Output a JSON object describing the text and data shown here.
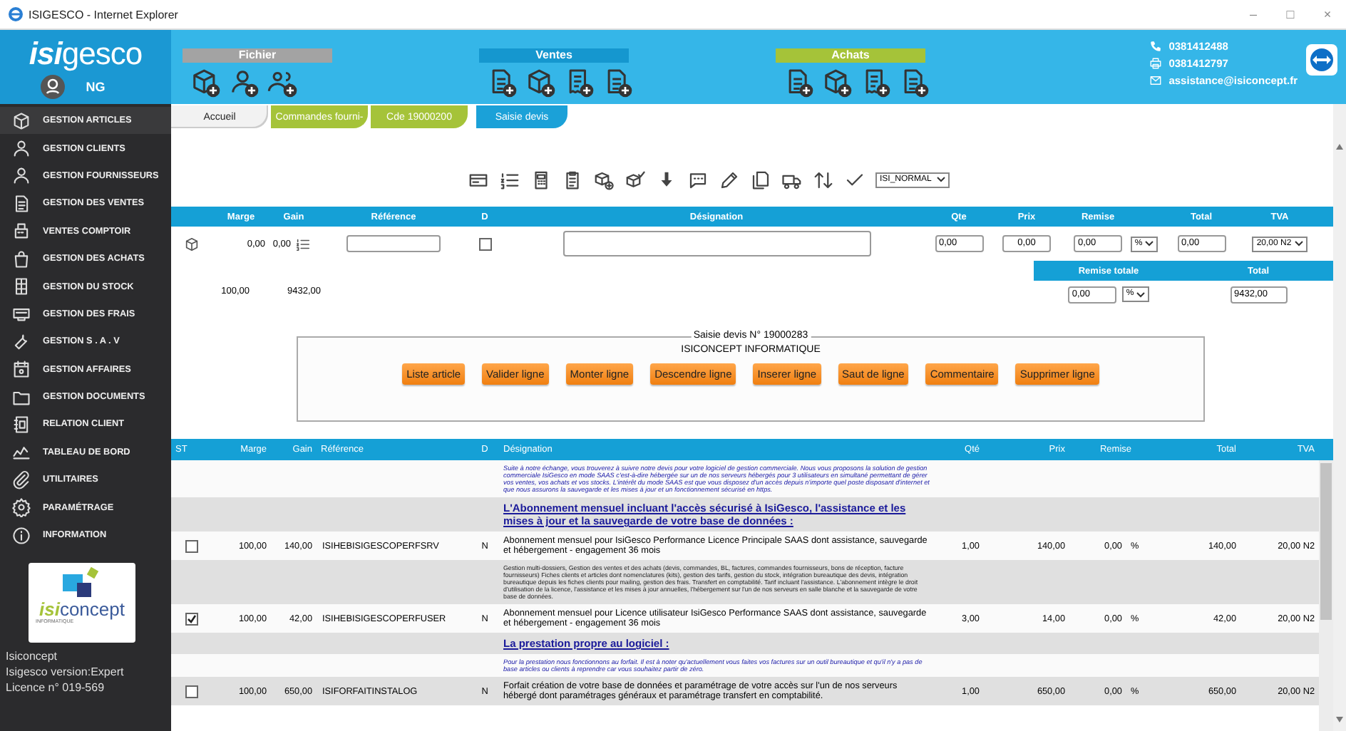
{
  "window": {
    "title": "ISIGESCO - Internet Explorer",
    "controls": [
      "–",
      "□",
      "×"
    ]
  },
  "header": {
    "logo": {
      "left": "isi",
      "right": "gesco"
    },
    "user": "NG",
    "groups": [
      {
        "label": "Fichier",
        "color": "#a3a3a3"
      },
      {
        "label": "Ventes",
        "color": "#1597cf"
      },
      {
        "label": "Achats",
        "color": "#a5c339"
      }
    ],
    "contacts": [
      {
        "kind": "phone",
        "text": "0381412488"
      },
      {
        "kind": "printer",
        "text": "0381412797"
      },
      {
        "kind": "mail",
        "text": "assistance@isiconcept.fr"
      }
    ]
  },
  "tabs": [
    {
      "label": "Accueil",
      "color": "#f2f2f2",
      "selected": false
    },
    {
      "label": "Commandes fourni-",
      "color": "#a5c339",
      "selected": false
    },
    {
      "label": "Cde 19000200",
      "color": "#a5c339",
      "selected": false
    },
    {
      "label": "Saisie devis",
      "color": "#1ba1d8",
      "selected": true
    }
  ],
  "sidebar": {
    "items": [
      {
        "label": "GESTION ARTICLES",
        "selected": true
      },
      {
        "label": "GESTION CLIENTS",
        "selected": false
      },
      {
        "label": "GESTION FOURNISSEURS",
        "selected": false
      },
      {
        "label": "GESTION DES VENTES",
        "selected": false
      },
      {
        "label": "VENTES COMPTOIR",
        "selected": false
      },
      {
        "label": "GESTION DES ACHATS",
        "selected": false
      },
      {
        "label": "GESTION DU STOCK",
        "selected": false
      },
      {
        "label": "GESTION DES FRAIS",
        "selected": false
      },
      {
        "label": "GESTION S . A . V",
        "selected": false
      },
      {
        "label": "GESTION AFFAIRES",
        "selected": false
      },
      {
        "label": "GESTION DOCUMENTS",
        "selected": false
      },
      {
        "label": "RELATION CLIENT",
        "selected": false
      },
      {
        "label": "TABLEAU DE BORD",
        "selected": false
      },
      {
        "label": "UTILITAIRES",
        "selected": false
      },
      {
        "label": "PARAMÉTRAGE",
        "selected": false
      },
      {
        "label": "INFORMATION",
        "selected": false
      }
    ],
    "brand": {
      "left": "isi",
      "right": "concept",
      "tagline": "INFORMATIQUE"
    },
    "footer": [
      "Isiconcept",
      "Isigesco version:Expert",
      "Licence n° 019-569"
    ]
  },
  "toolbar": {
    "select": "ISI_NORMAL"
  },
  "entry": {
    "columns": [
      "",
      "Marge",
      "Gain",
      "Référence",
      "D",
      "Désignation",
      "Qte",
      "Prix",
      "Remise",
      "",
      "Total",
      "TVA"
    ],
    "row": {
      "marge": "0,00",
      "gain": "0,00",
      "d_checked": false,
      "qte": "0,00",
      "prix": "0,00",
      "remise": "0,00",
      "remise_type": "%",
      "total": "0,00",
      "tva": "20,00 N2"
    },
    "totals": {
      "marge": "100,00",
      "gain": "9432,00",
      "remise_label": "Remise totale",
      "total_label": "Total",
      "remise": "0,00",
      "remise_type": "%",
      "total": "9432,00"
    }
  },
  "action_box": {
    "legend": "Saisie devis N° 19000283",
    "company": "ISICONCEPT INFORMATIQUE",
    "buttons": [
      "Liste article",
      "Valider ligne",
      "Monter ligne",
      "Descendre ligne",
      "Inserer ligne",
      "Saut de ligne",
      "Commentaire",
      "Supprimer ligne"
    ]
  },
  "lines": {
    "columns": [
      "ST",
      "Marge",
      "Gain",
      "Référence",
      "D",
      "Désignation",
      "Qté",
      "Prix",
      "Remise",
      "Total",
      "TVA"
    ],
    "rows": [
      {
        "kind": "comment",
        "text": "Suite à notre échange, vous trouverez à suivre notre devis pour votre logiciel de gestion commerciale. Nous vous proposons la solution de gestion commerciale IsiGesco en mode SAAS c'est-à-dire hébergée sur un de nos serveurs hébergés pour 3 utilisateurs en simultané permettant de gérer vos ventes, vos achats et vos stocks. L'intérêt du mode SAAS est que vous disposez d'un accès depuis n'importe quel poste disposant d'internet et que nous assurons la sauvegarde et les mises à jour et un fonctionnement sécurisé en https."
      },
      {
        "kind": "title",
        "text": "L'Abonnement mensuel incluant l'accès sécurisé à IsiGesco, l'assistance et les mises à jour et la sauvegarde de votre base de données :"
      },
      {
        "kind": "article",
        "checked": false,
        "marge": "100,00",
        "gain": "140,00",
        "reference": "ISIHEBISIGESCOPERFSRV",
        "d": "N",
        "designation": "Abonnement mensuel pour IsiGesco Performance Licence Principale SAAS dont assistance, sauvegarde et hébergement - engagement 36 mois",
        "qte": "1,00",
        "prix": "140,00",
        "remise": "0,00",
        "remise_type": "%",
        "total": "140,00",
        "tva": "20,00 N2"
      },
      {
        "kind": "detail",
        "text": "Gestion multi-dossiers, Gestion des ventes et des achats (devis, commandes, BL, factures, commandes fournisseurs, bons de réception, facture fournisseurs) Fiches clients et articles dont nomenclatures (kits), gestion des tarifs, gestion du stock, intégration bureautique des devis, intégration bureautique depuis les fiches clients pour mailing, gestion des frais. Transfert en comptabilité. Tarif incluant l'assistance. L'abonnement intègre le droit d'utilisation de la licence, l'assistance et les mises à jour annuelles, l'hébergement sur l'un de nos serveurs en salle blanche et la sauvegarde de votre base de données."
      },
      {
        "kind": "article",
        "checked": true,
        "marge": "100,00",
        "gain": "42,00",
        "reference": "ISIHEBISIGESCOPERFUSER",
        "d": "N",
        "designation": "Abonnement mensuel pour Licence utilisateur IsiGesco Performance SAAS dont assistance, sauvegarde et hébergement - engagement 36 mois",
        "qte": "3,00",
        "prix": "14,00",
        "remise": "0,00",
        "remise_type": "%",
        "total": "42,00",
        "tva": "20,00 N2"
      },
      {
        "kind": "title",
        "text": "La prestation propre au logiciel :"
      },
      {
        "kind": "comment",
        "text": "Pour la prestation nous fonctionnons au forfait. Il est à noter qu'actuellement vous faites vos factures sur un outil bureautique et qu'il n'y a pas de base articles ou clients à reprendre car vous souhaitez partir de zéro."
      },
      {
        "kind": "article",
        "checked": false,
        "marge": "100,00",
        "gain": "650,00",
        "reference": "ISIFORFAITINSTALOG",
        "d": "N",
        "designation": "Forfait création de votre base de données et paramétrage de votre accès sur l'un de nos serveurs hébergé dont paramétrages généraux et paramétrage transfert en comptabilité.",
        "qte": "1,00",
        "prix": "650,00",
        "remise": "0,00",
        "remise_type": "%",
        "total": "650,00",
        "tva": "20,00 N2"
      }
    ]
  }
}
